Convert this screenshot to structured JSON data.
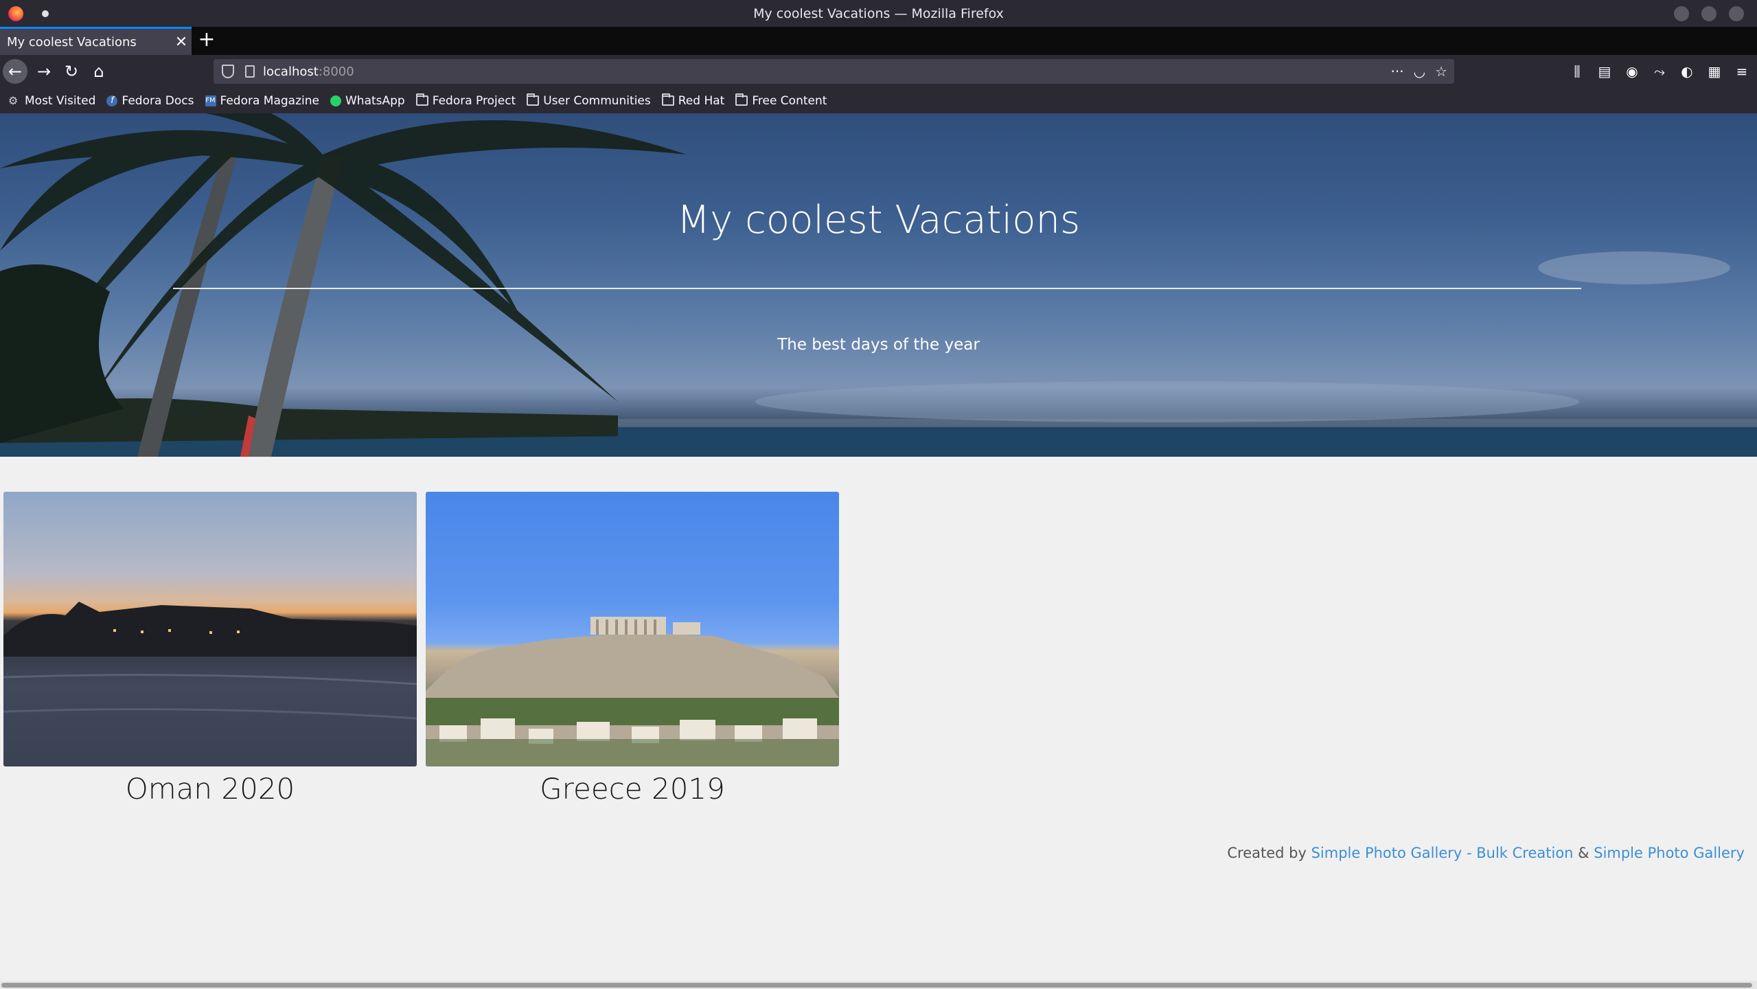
{
  "window": {
    "title": "My coolest Vacations — Mozilla Firefox"
  },
  "tabs": [
    {
      "label": "My coolest Vacations",
      "active": true
    }
  ],
  "icons": {
    "close": "✕",
    "new_tab": "+",
    "back": "←",
    "forward": "→",
    "reload": "↻",
    "home": "⌂",
    "more": "···",
    "pocket": "◡",
    "star": "☆",
    "library": "⫼",
    "sidebar": "▤",
    "account": "◉",
    "extension_1": "⤳",
    "extension_2": "◐",
    "extensions": "▦",
    "menu": "≡",
    "gear": "⚙",
    "fedora": "f",
    "fedora_magazine": "FM"
  },
  "navbar": {
    "url_host": "localhost",
    "url_port": ":8000"
  },
  "bookmarks": [
    {
      "label": "Most Visited",
      "icon": "gear-icon"
    },
    {
      "label": "Fedora Docs",
      "icon": "fedora-icon"
    },
    {
      "label": "Fedora Magazine",
      "icon": "fedora-magazine-icon"
    },
    {
      "label": "WhatsApp",
      "icon": "whatsapp-icon"
    },
    {
      "label": "Fedora Project",
      "icon": "folder-icon"
    },
    {
      "label": "User Communities",
      "icon": "folder-icon"
    },
    {
      "label": "Red Hat",
      "icon": "folder-icon"
    },
    {
      "label": "Free Content",
      "icon": "folder-icon"
    }
  ],
  "hero": {
    "title": "My coolest Vacations",
    "subtitle": "The best days of the year"
  },
  "albums": [
    {
      "caption": "Oman 2020"
    },
    {
      "caption": "Greece 2019"
    }
  ],
  "footer": {
    "prefix": "Created by ",
    "link1": "Simple Photo Gallery - Bulk Creation",
    "separator": " & ",
    "link2": "Simple Photo Gallery"
  },
  "colors": {
    "accent": "#0a84ff",
    "link": "#3b8fd6",
    "page_bg": "#f0f0f0",
    "chrome_bg": "#2b2a33"
  }
}
